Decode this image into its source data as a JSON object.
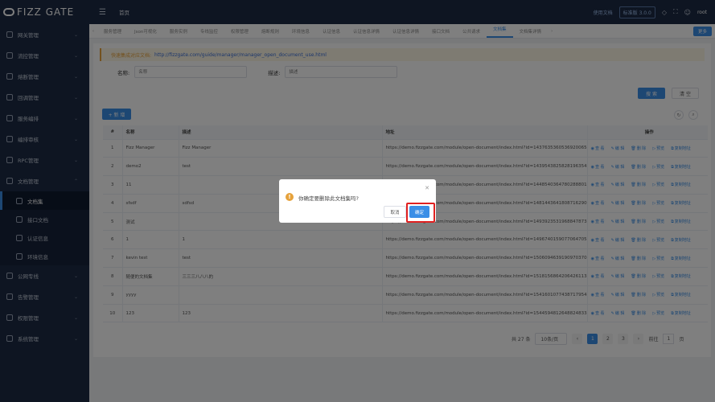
{
  "brand": "FIZZ GATE",
  "topbar": {
    "home": "首页",
    "doc_link": "使用文档",
    "version": "标准版 3.0.0",
    "user": "root"
  },
  "sidebar": {
    "items": [
      {
        "label": "网关管理"
      },
      {
        "label": "流控管理"
      },
      {
        "label": "熔断管理"
      },
      {
        "label": "回调管理"
      },
      {
        "label": "服务编排"
      },
      {
        "label": "编排审核"
      },
      {
        "label": "RPC管理"
      },
      {
        "label": "文档管理"
      }
    ],
    "sub_items": [
      {
        "label": "文档集"
      },
      {
        "label": "接口文档"
      },
      {
        "label": "认证信息"
      },
      {
        "label": "环境信息"
      }
    ],
    "items_after": [
      {
        "label": "公网专线"
      },
      {
        "label": "告警管理"
      },
      {
        "label": "权限管理"
      },
      {
        "label": "系统管理"
      }
    ]
  },
  "tabs": [
    "服务管理",
    "Json可视化",
    "服务实例",
    "专线监控",
    "权限管理",
    "熔断规则",
    "环境信息",
    "认证信息",
    "认证信息详情",
    "认证信息详情",
    "接口文档",
    "公共请求",
    "文档集",
    "文档集详情"
  ],
  "more_label": "更多",
  "hint": {
    "label": "快速集成对应文档:",
    "url": "http://fizzgate.com/guide/manager/manager_open_document_use.html"
  },
  "search": {
    "name_label": "名称:",
    "name_placeholder": "名称",
    "desc_label": "描述:",
    "desc_placeholder": "描述"
  },
  "buttons": {
    "search": "搜 索",
    "clear": "清 空",
    "add": "+ 新 增"
  },
  "table": {
    "headers": [
      "#",
      "名称",
      "描述",
      "地址",
      "操作"
    ],
    "op_labels": [
      "查 看",
      "编 辑",
      "删 除",
      "预览",
      "复制地址"
    ],
    "rows": [
      {
        "n": "1",
        "name": "Fizz Manager",
        "desc": "Fizz Manager",
        "url": "https://demo.fizzgate.com/module/open-document/index.html?id=1437635360536920065"
      },
      {
        "n": "2",
        "name": "demo2",
        "desc": "test",
        "url": "https://demo.fizzgate.com/module/open-document/index.html?id=1439543825828196354"
      },
      {
        "n": "3",
        "name": "11",
        "desc": "",
        "url": "https://demo.fizzgate.com/module/open-document/index.html?id=1448540364780288801"
      },
      {
        "n": "4",
        "name": "sfsdf",
        "desc": "sdfsd",
        "url": "https://demo.fizzgate.com/module/open-document/index.html?id=1481443641808716290"
      },
      {
        "n": "5",
        "name": "测试",
        "desc": "",
        "url": "https://demo.fizzgate.com/module/open-document/index.html?id=1493923531968847873"
      },
      {
        "n": "6",
        "name": "1",
        "desc": "1",
        "url": "https://demo.fizzgate.com/module/open-document/index.html?id=1496740159077064705"
      },
      {
        "n": "7",
        "name": "kevin test",
        "desc": "test",
        "url": "https://demo.fizzgate.com/module/open-document/index.html?id=1506094639190970370"
      },
      {
        "n": "8",
        "name": "随便的文档集",
        "desc": "三三三八八八的",
        "url": "https://demo.fizzgate.com/module/open-document/index.html?id=1518156864206426113"
      },
      {
        "n": "9",
        "name": "yyyy",
        "desc": "",
        "url": "https://demo.fizzgate.com/module/open-document/index.html?id=1541601077438717954"
      },
      {
        "n": "10",
        "name": "123",
        "desc": "123",
        "url": "https://demo.fizzgate.com/module/open-document/index.html?id=1544594812648824833"
      }
    ]
  },
  "pager": {
    "total": "共 27 条",
    "page_size": "10条/页",
    "pages": [
      "1",
      "2",
      "3"
    ],
    "goto_label": "前往",
    "goto_value": "1",
    "page_suffix": "页"
  },
  "modal": {
    "message": "你确定要删除此文档集吗?",
    "cancel": "取消",
    "ok": "确定"
  }
}
